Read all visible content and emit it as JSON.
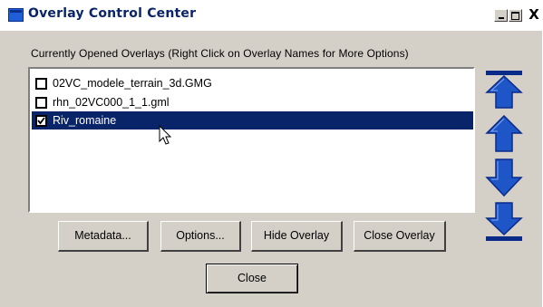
{
  "window": {
    "title": "Overlay Control Center",
    "controls": {
      "minimize_icon": "minimize-icon",
      "maximize_icon": "maximize-icon",
      "close_glyph": "X"
    }
  },
  "list": {
    "label": "Currently Opened Overlays (Right Click on Overlay Names for More Options)",
    "items": [
      {
        "name": "02VC_modele_terrain_3d.GMG",
        "checked": false,
        "selected": false
      },
      {
        "name": "rhn_02VC000_1_1.gml",
        "checked": false,
        "selected": false
      },
      {
        "name": "Riv_romaine",
        "checked": true,
        "selected": true
      }
    ]
  },
  "order_controls": [
    {
      "name": "move-to-top",
      "icon": "arrow-to-top-icon"
    },
    {
      "name": "move-up",
      "icon": "arrow-up-icon"
    },
    {
      "name": "move-down",
      "icon": "arrow-down-icon"
    },
    {
      "name": "move-to-bottom",
      "icon": "arrow-to-bottom-icon"
    }
  ],
  "buttons": {
    "metadata": "Metadata...",
    "options": "Options...",
    "hide_overlay": "Hide Overlay",
    "close_overlay": "Close Overlay",
    "close": "Close"
  },
  "colors": {
    "selection": "#0a246a",
    "arrow_fill": "#1e56c8",
    "arrow_dark": "#0a2a8a",
    "dialog_bg": "#d4d0c8"
  }
}
